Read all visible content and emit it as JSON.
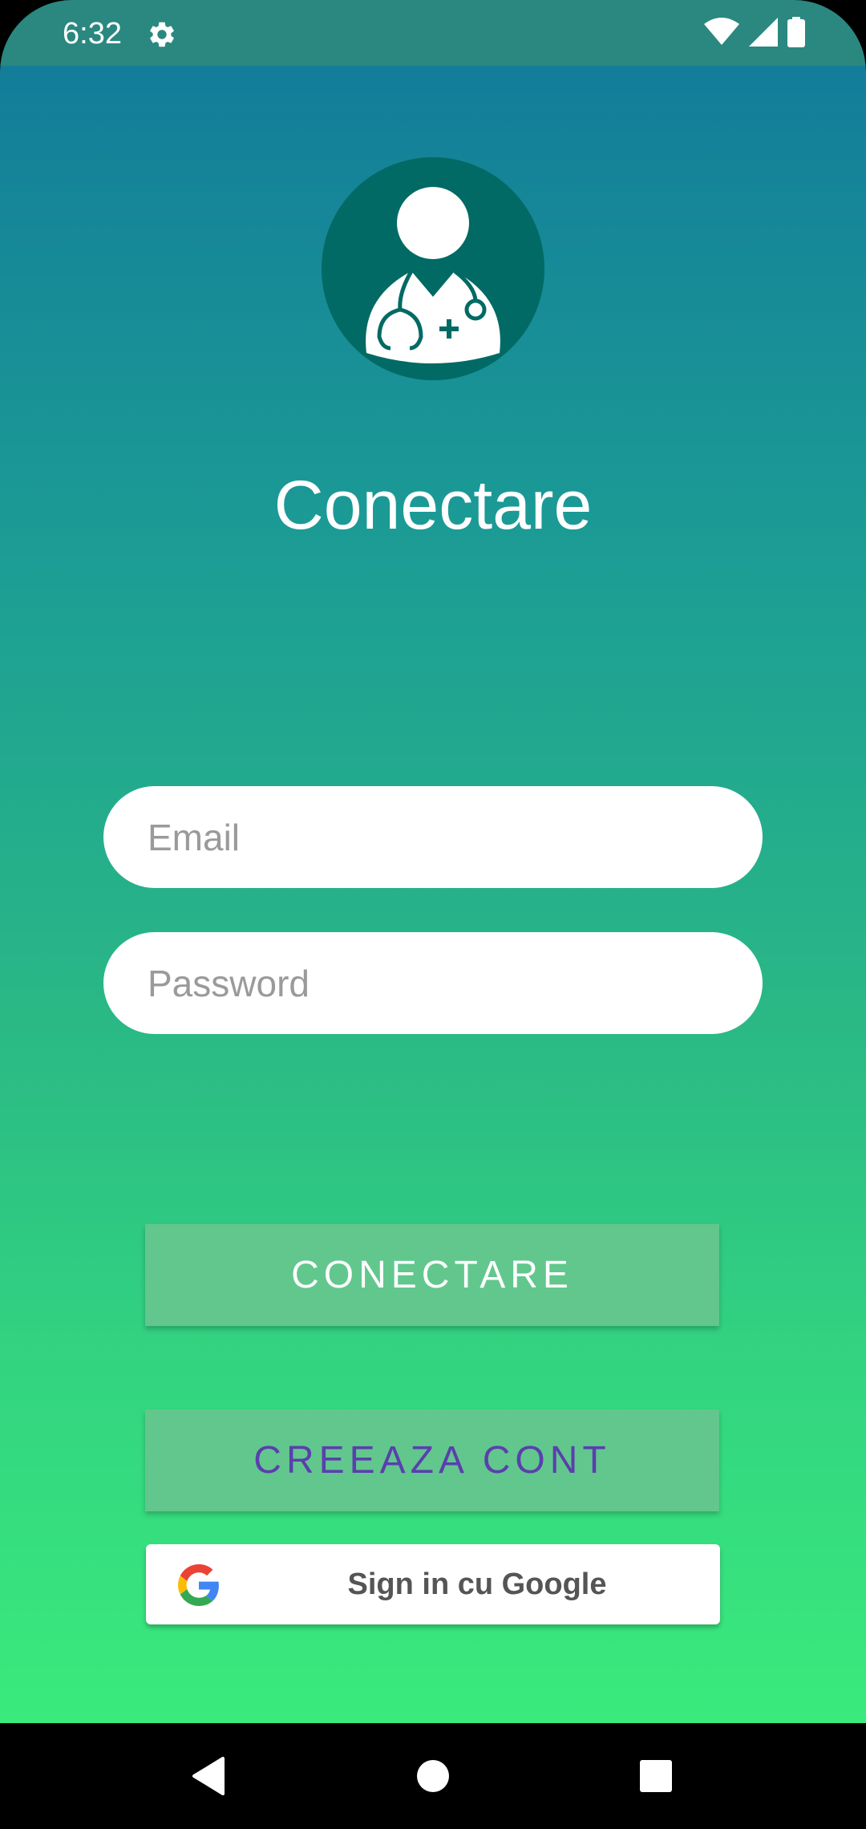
{
  "status_bar": {
    "time": "6:32",
    "icons": [
      "gear-icon",
      "wifi-icon",
      "signal-icon",
      "battery-icon"
    ]
  },
  "header": {
    "avatar_icon": "doctor-icon",
    "title": "Conectare"
  },
  "form": {
    "email_placeholder": "Email",
    "password_placeholder": "Password"
  },
  "actions": {
    "login_label": "CONECTARE",
    "create_account_label": "CREEAZA CONT",
    "google_label": "Sign in cu Google",
    "google_icon": "google-logo-icon"
  },
  "nav_bar": {
    "icons": [
      "back-icon",
      "home-icon",
      "recents-icon"
    ]
  },
  "colors": {
    "status_bar": "#2a8880",
    "gradient_top": "#137d99",
    "gradient_bottom": "#3aea7c",
    "avatar_circle": "#026a64",
    "button_fill": "#62c78d",
    "create_account_text": "#5a3fae"
  }
}
